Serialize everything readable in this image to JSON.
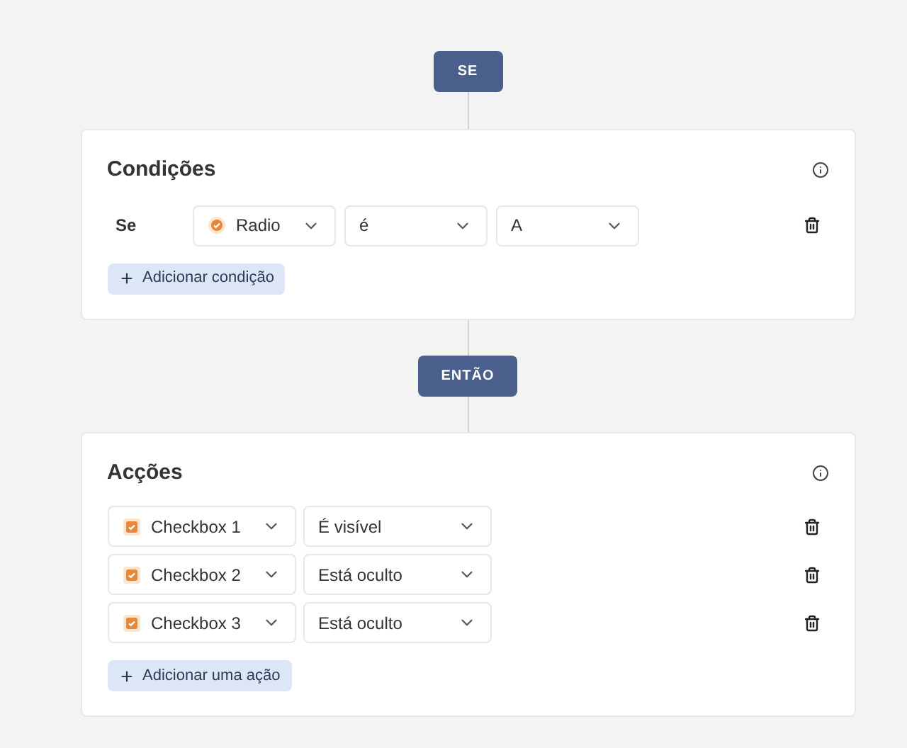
{
  "if_button": {
    "label": "SE"
  },
  "conditions": {
    "title": "Condições",
    "row_label": "Se",
    "field": {
      "kind": "radio",
      "label": "Radio"
    },
    "operator": "é",
    "value": "A",
    "add_button": "Adicionar condição"
  },
  "then_button": {
    "label": "ENTÃO"
  },
  "actions": {
    "title": "Acções",
    "rows": [
      {
        "field": {
          "kind": "checkbox",
          "label": "Checkbox 1"
        },
        "action": "É visível"
      },
      {
        "field": {
          "kind": "checkbox",
          "label": "Checkbox 2"
        },
        "action": "Está oculto"
      },
      {
        "field": {
          "kind": "checkbox",
          "label": "Checkbox 3"
        },
        "action": "Está oculto"
      }
    ],
    "add_button": "Adicionar uma ação"
  }
}
